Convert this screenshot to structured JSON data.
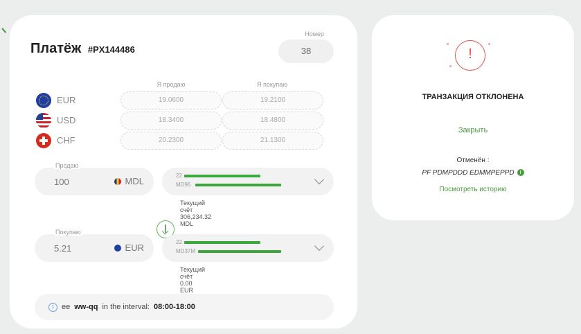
{
  "payment": {
    "title": "Платёж",
    "id": "#PX144486",
    "number_label": "Номер",
    "number_value": "38"
  },
  "rates": {
    "sell_header": "Я продаю",
    "buy_header": "Я покупаю",
    "rows": [
      {
        "currency": "EUR",
        "flag": "eu-flag-icon",
        "sell": "19.0600",
        "buy": "19.2100"
      },
      {
        "currency": "USD",
        "flag": "us-flag-icon",
        "sell": "18.3400",
        "buy": "18.4800"
      },
      {
        "currency": "CHF",
        "flag": "ch-flag-icon",
        "sell": "20.2300",
        "buy": "21.1300"
      }
    ]
  },
  "sell": {
    "label": "Продаю",
    "amount": "100",
    "currency": "MDL",
    "account_line1": "22",
    "account_line2": "MD96",
    "balance": "Текущий счёт 306,234.32 MDL"
  },
  "buy": {
    "label": "Покупаю",
    "amount": "5.21",
    "currency": "EUR",
    "account_line1": "22",
    "account_line2": "MD37M",
    "balance": "Текущий счёт 0.00 EUR"
  },
  "info": {
    "prefix": "ee",
    "bold1": "ww-qq",
    "middle": "in the interval:",
    "bold2": "08:00-18:00"
  },
  "status": {
    "title": "ТРАНЗАКЦИЯ ОТКЛОНЕНА",
    "close": "Закрыть",
    "cancelled_label": "Отменён :",
    "cancelled_ref": "PF PDMPDDD EDMMPEPPD",
    "history": "Посмотреть историю"
  },
  "colors": {
    "accent": "#4a9d3f",
    "error": "#e05050",
    "background": "#eceeed",
    "redaction": "#3ea63e"
  }
}
